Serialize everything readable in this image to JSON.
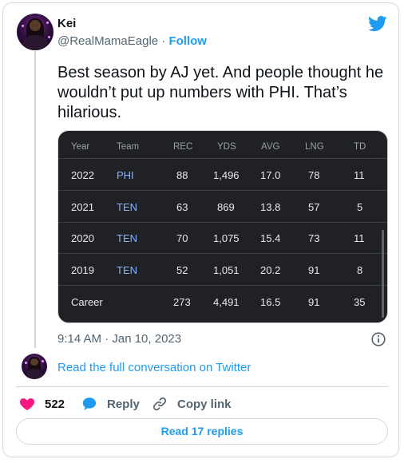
{
  "tweet": {
    "author_name": "Kei",
    "handle": "@RealMamaEagle",
    "separator": "·",
    "follow_label": "Follow",
    "text": "Best season by AJ yet. And people thought he wouldn’t put up numbers with PHI. That’s hilarious.",
    "timestamp": "9:14 AM · Jan 10, 2023"
  },
  "stats_table": {
    "headers": [
      "Year",
      "Team",
      "REC",
      "YDS",
      "AVG",
      "LNG",
      "TD"
    ],
    "rows": [
      [
        "2022",
        "PHI",
        "88",
        "1,496",
        "17.0",
        "78",
        "11"
      ],
      [
        "2021",
        "TEN",
        "63",
        "869",
        "13.8",
        "57",
        "5"
      ],
      [
        "2020",
        "TEN",
        "70",
        "1,075",
        "15.4",
        "73",
        "11"
      ],
      [
        "2019",
        "TEN",
        "52",
        "1,051",
        "20.2",
        "91",
        "8"
      ],
      [
        "Career",
        "",
        "273",
        "4,491",
        "16.5",
        "91",
        "35"
      ]
    ]
  },
  "conversation": {
    "link_label": "Read the full conversation on Twitter"
  },
  "actions": {
    "like_count": "522",
    "reply_label": "Reply",
    "copy_link_label": "Copy link"
  },
  "replies_button": "Read 17 replies",
  "icons": {
    "brand": "twitter-bird-icon",
    "info": "info-icon",
    "like": "heart-icon",
    "reply": "speech-bubble-icon",
    "copy": "link-icon"
  },
  "colors": {
    "accent": "#1d9bf0",
    "like": "#f91880",
    "text": "#0f1419",
    "muted": "#536471",
    "table_bg": "#202124",
    "team_link": "#8ab4f8"
  }
}
